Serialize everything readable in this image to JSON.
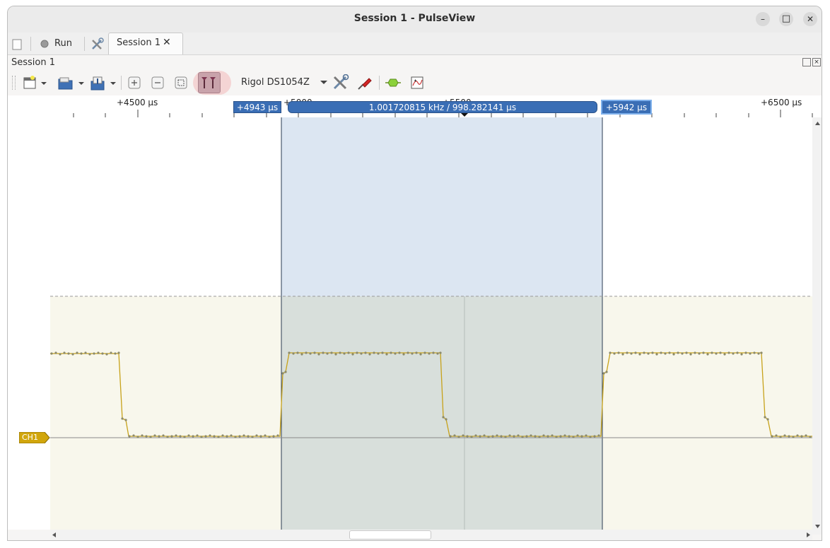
{
  "window": {
    "title": "Session 1 - PulseView",
    "controls": {
      "minimize": "–",
      "maximize": "□",
      "close": "✕"
    }
  },
  "tabs": {
    "run_label": "Run",
    "session_tab_label": "Session 1",
    "close_glyph": "✕"
  },
  "session": {
    "label": "Session 1"
  },
  "toolbar": {
    "device_name": "Rigol DS1054Z",
    "icons": [
      "new-session-icon",
      "open-file-icon",
      "save-file-icon",
      "zoom-in-icon",
      "zoom-out-icon",
      "zoom-fit-icon",
      "cursors-icon",
      "device-settings-icon",
      "probe-icon",
      "decoder-icon",
      "math-icon"
    ]
  },
  "ruler": {
    "labels": [
      "+4500 µs",
      "+5000",
      "+5500",
      "+6500 µs"
    ]
  },
  "cursors": {
    "left": "+4943 µs",
    "right": "+5942 µs",
    "measurement": "1.001720815 kHz / 998.282141 µs"
  },
  "channel": {
    "name": "CH1",
    "color": "#d1a60c"
  },
  "colors": {
    "selection": "#dce6f2",
    "trace_bg": "#f8f7ec",
    "trace": "#c7a21a",
    "flag": "#3a6eb5",
    "cursor_button_highlight": "#f4c6c6"
  }
}
